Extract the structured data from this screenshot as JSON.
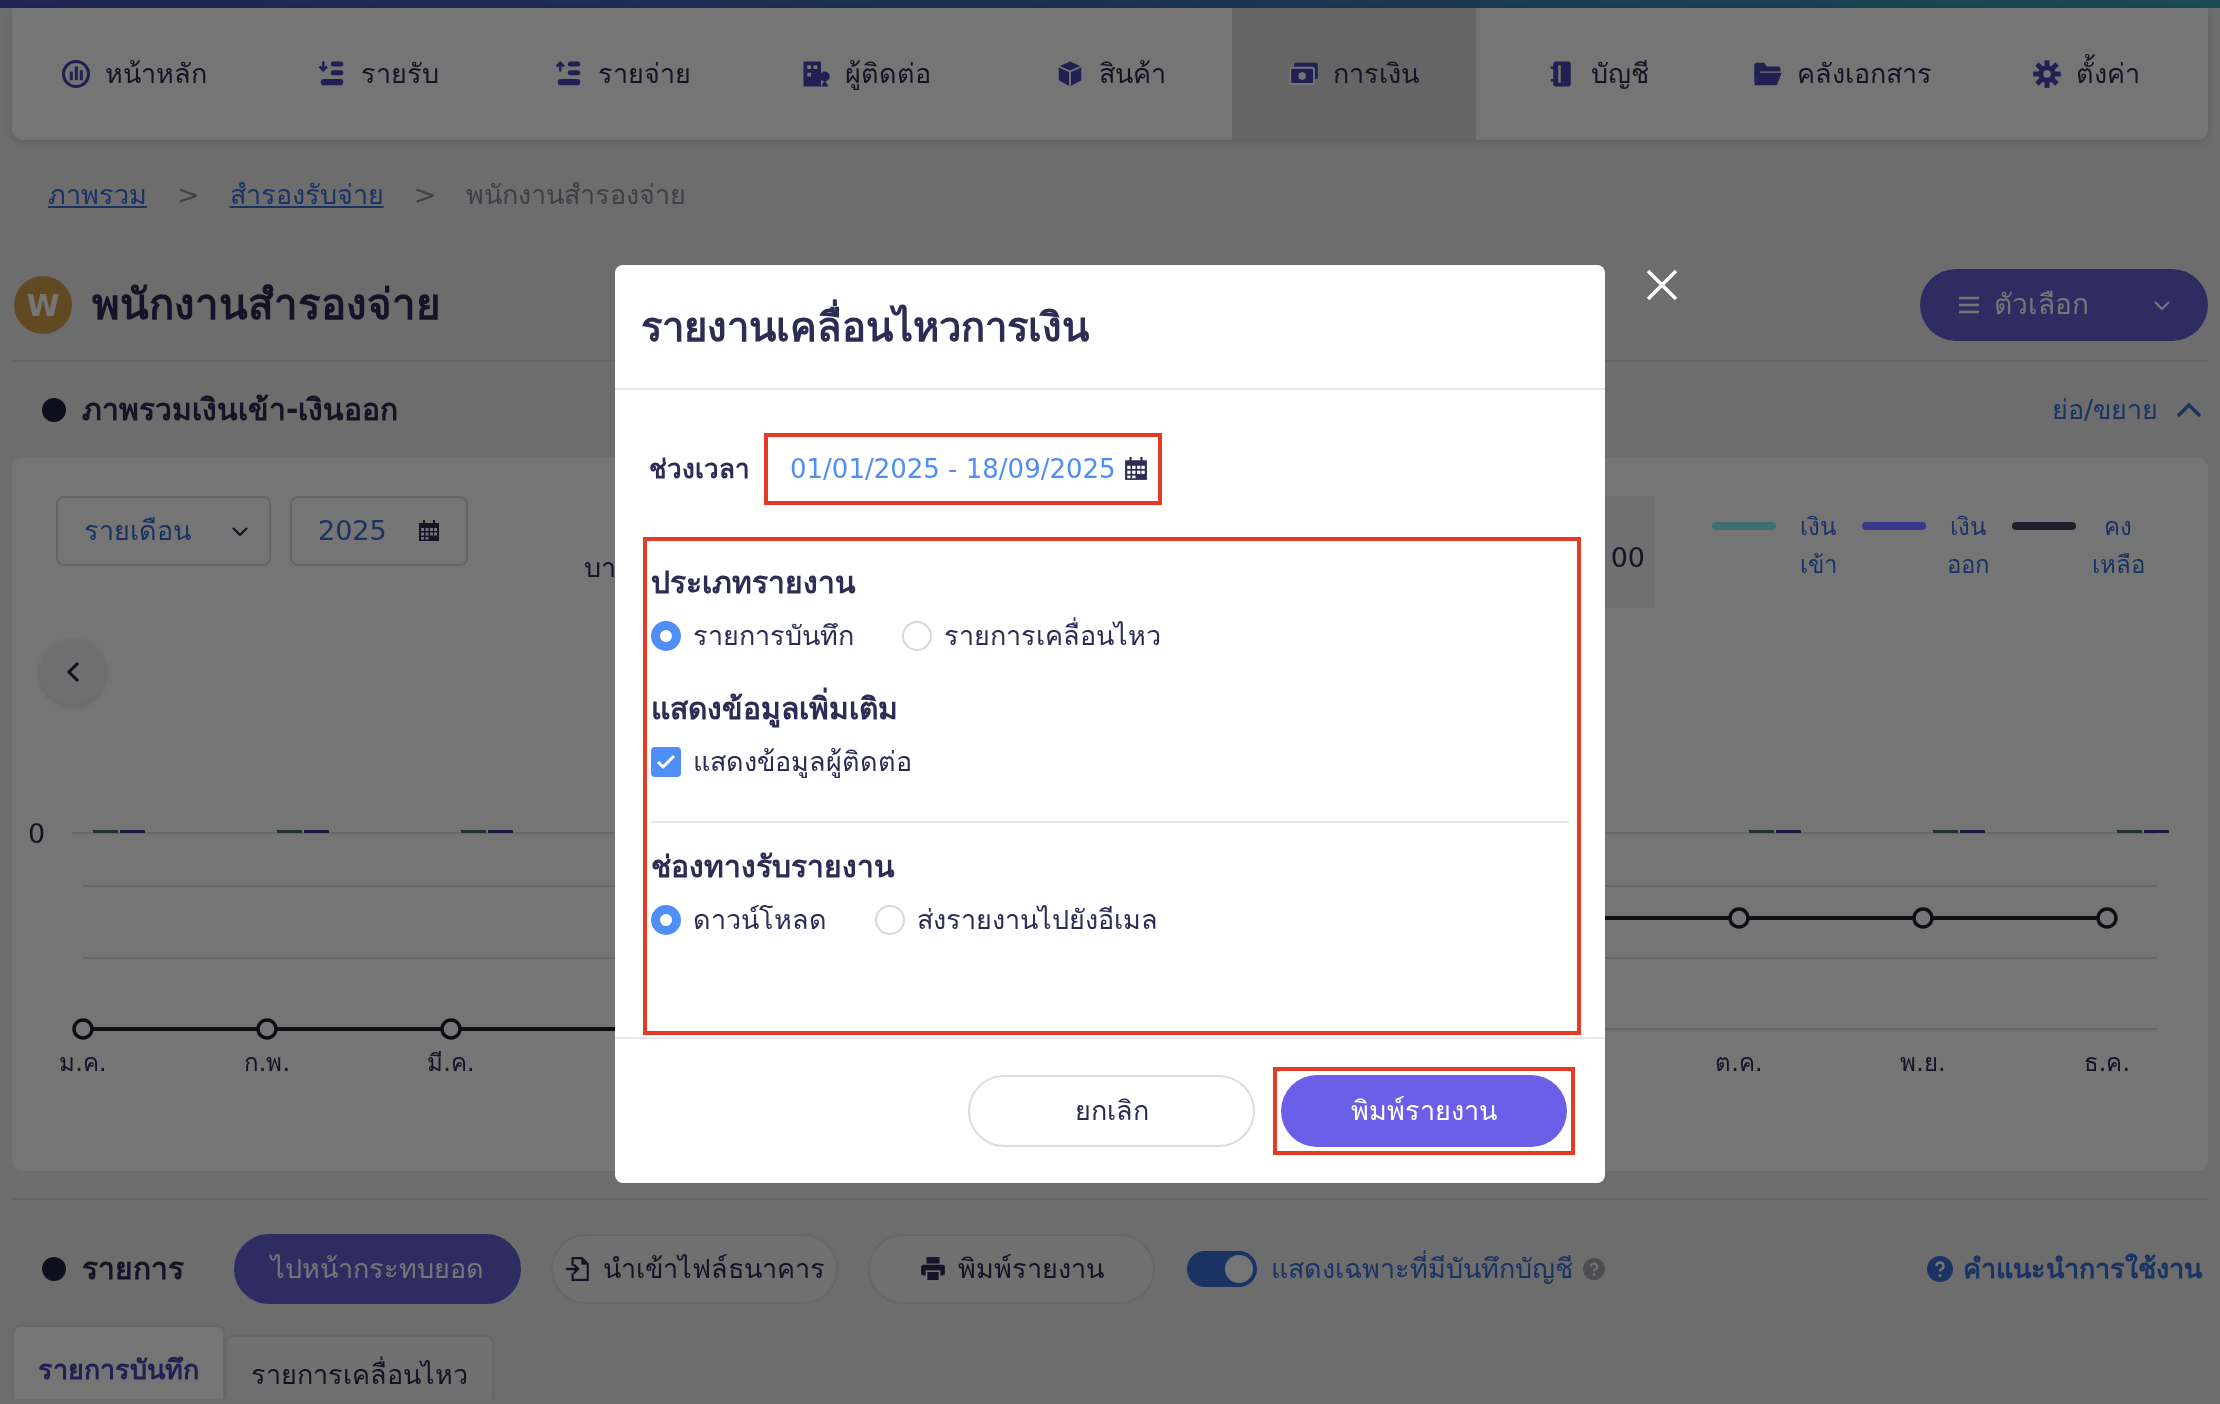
{
  "nav": {
    "items": [
      {
        "label": "หน้าหลัก",
        "selected": false
      },
      {
        "label": "รายรับ",
        "selected": false
      },
      {
        "label": "รายจ่าย",
        "selected": false
      },
      {
        "label": "ผู้ติดต่อ",
        "selected": false
      },
      {
        "label": "สินค้า",
        "selected": false
      },
      {
        "label": "การเงิน",
        "selected": true
      },
      {
        "label": "บัญชี",
        "selected": false
      },
      {
        "label": "คลังเอกสาร",
        "selected": false
      },
      {
        "label": "ตั้งค่า",
        "selected": false
      }
    ]
  },
  "breadcrumb": {
    "separator": ">",
    "items": [
      {
        "label": "ภาพรวม",
        "current": false
      },
      {
        "label": "สำรองรับจ่าย",
        "current": false
      },
      {
        "label": "พนักงานสำรองจ่าย",
        "current": true
      }
    ]
  },
  "page": {
    "avatar": "W",
    "title": "พนักงานสำรองจ่าย",
    "options_button": "ตัวเลือก"
  },
  "overview": {
    "heading": "ภาพรวมเงินเข้า-เงินออก",
    "collapse_link": "ย่อ/ขยาย",
    "period_select": "รายเดือน",
    "year": "2025",
    "cut_label": "บา",
    "cut_value": "00",
    "legend": [
      {
        "label": "เงิน เข้า",
        "color": "#3d6e70"
      },
      {
        "label": "เงิน ออก",
        "color": "#38388c"
      },
      {
        "label": "คง เหลือ",
        "color": "#1e1e2d"
      }
    ],
    "chart": {
      "y_label": "0",
      "months_left": [
        "ม.ค.",
        "ก.พ.",
        "มี.ค."
      ],
      "months_right": [
        "ต.ค.",
        "พ.ย.",
        "ธ.ค."
      ]
    }
  },
  "list_section": {
    "heading": "รายการ",
    "buttons": [
      {
        "label": "ไปหน้ากระทบยอด",
        "kind": "primary"
      },
      {
        "label": "นำเข้าไฟล์ธนาคาร",
        "kind": "import"
      },
      {
        "label": "พิมพ์รายงาน",
        "kind": "print"
      }
    ],
    "toggle": {
      "label": "แสดงเฉพาะที่มีบันทึกบัญชี",
      "on": true
    },
    "help": "คำแนะนำการใช้งาน",
    "tabs": [
      {
        "label": "รายการบันทึก",
        "selected": true
      },
      {
        "label": "รายการเคลื่อนไหว",
        "selected": false
      }
    ]
  },
  "modal": {
    "title": "รายงานเคลื่อนไหวการเงิน",
    "date_label": "ช่วงเวลา",
    "date_range": "01/01/2025 - 18/09/2025",
    "date_highlighted": true,
    "options_highlighted": true,
    "report_type": {
      "heading": "ประเภทรายงาน",
      "options": [
        {
          "label": "รายการบันทึก",
          "selected": true
        },
        {
          "label": "รายการเคลื่อนไหว",
          "selected": false
        }
      ]
    },
    "extra": {
      "heading": "แสดงข้อมูลเพิ่มเติม",
      "options": [
        {
          "label": "แสดงข้อมูลผู้ติดต่อ",
          "checked": true
        }
      ]
    },
    "channel": {
      "heading": "ช่องทางรับรายงาน",
      "options": [
        {
          "label": "ดาวน์โหลด",
          "selected": true
        },
        {
          "label": "ส่งรายงานไปยังอีเมล",
          "selected": false
        }
      ]
    },
    "cancel": "ยกเลิก",
    "print": "พิมพ์รายงาน",
    "print_highlighted": true
  }
}
